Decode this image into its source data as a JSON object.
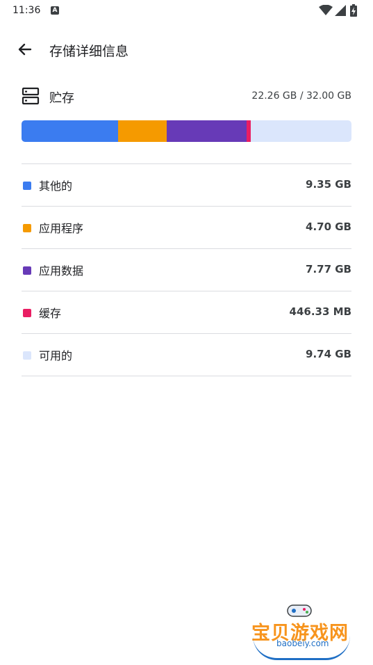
{
  "status_bar": {
    "time": "11:36",
    "notification_icon": "a-icon",
    "icons": [
      "wifi-icon",
      "signal-icon",
      "battery-charging-icon"
    ]
  },
  "app_bar": {
    "back_icon": "arrow-left-icon",
    "title": "存储详细信息"
  },
  "storage": {
    "icon": "storage-icon",
    "label": "贮存",
    "usage": "22.26 GB / 32.00 GB",
    "used_fraction": 0.6956,
    "total_gb": 32.0
  },
  "breakdown": [
    {
      "label": "其他的",
      "value": "9.35 GB",
      "gb": 9.35,
      "color": "#3b7cf0"
    },
    {
      "label": "应用程序",
      "value": "4.70 GB",
      "gb": 4.7,
      "color": "#f59a00"
    },
    {
      "label": "应用数据",
      "value": "7.77 GB",
      "gb": 7.77,
      "color": "#673ab7"
    },
    {
      "label": "缓存",
      "value": "446.33 MB",
      "gb": 0.446,
      "color": "#e91e63"
    },
    {
      "label": "可用的",
      "value": "9.74 GB",
      "gb": 9.74,
      "color": "#dbe6fc"
    }
  ],
  "watermark": {
    "title": "宝贝游戏网",
    "url": "baobeiy.com"
  }
}
